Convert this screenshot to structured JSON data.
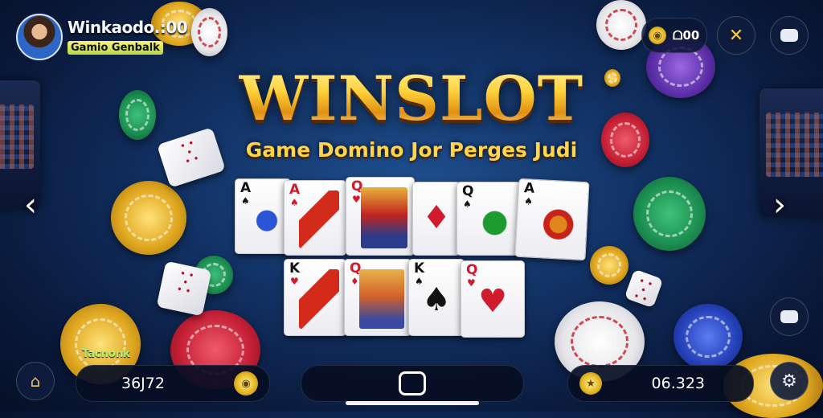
{
  "header": {
    "username": "Winkaodo.:00",
    "badge_text": "Gamio Genbalk",
    "coin_balance": "ᗝ00"
  },
  "title": {
    "main": "WINSLOT",
    "tagline": "Game Domino Jor Perges Judi"
  },
  "cards": {
    "row1": [
      {
        "rank": "A",
        "suit": "♠",
        "color": "black"
      },
      {
        "rank": "A",
        "suit": "♠",
        "color": "red"
      },
      {
        "rank": "Q",
        "suit": "♥",
        "color": "red"
      },
      {
        "rank": "",
        "suit": "♦",
        "color": "red"
      },
      {
        "rank": "Q",
        "suit": "♠",
        "color": "black"
      },
      {
        "rank": "A",
        "suit": "♠",
        "color": "red"
      }
    ],
    "row2": [
      {
        "rank": "K",
        "suit": "♥",
        "color": "red"
      },
      {
        "rank": "Q",
        "suit": "♦",
        "color": "red"
      },
      {
        "rank": "K",
        "suit": "♠",
        "color": "black"
      },
      {
        "rank": "Q",
        "suit": "♥",
        "color": "red"
      }
    ]
  },
  "bottom": {
    "label": "Tacnonk",
    "left_amount": "36J72",
    "right_amount": "06.323"
  },
  "icons": {
    "profile": "avatar-icon",
    "coin": "coin-icon",
    "bonus": "bonus-icon",
    "chat": "chat-icon",
    "home": "home-icon",
    "settings": "settings-icon"
  },
  "colors": {
    "title_gold": "#ffcf3a",
    "background": "#123265",
    "badge": "#b7d84a"
  }
}
